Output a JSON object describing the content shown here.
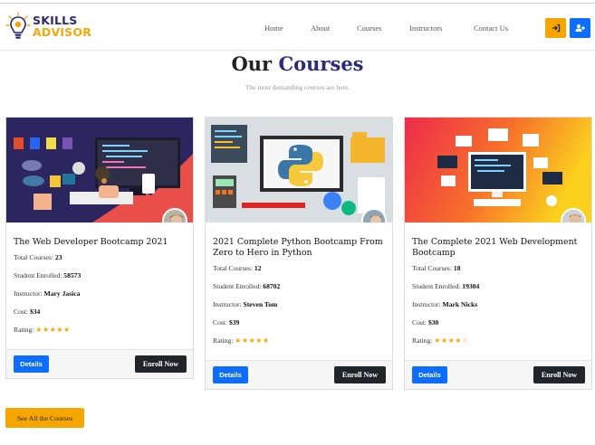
{
  "brand": {
    "line1": "SKILLS",
    "line2": "ADVISOR"
  },
  "nav": {
    "items": [
      "Home",
      "About",
      "Courses",
      "Instructors",
      "Contact Us"
    ],
    "login_icon": "sign-in-icon",
    "register_icon": "user-plus-icon"
  },
  "section": {
    "title_plain": "Our ",
    "title_accent": "Courses",
    "subtitle": "The most demanding courses are here."
  },
  "labels": {
    "total_courses": "Total Courses:",
    "students": "Student Enrolled:",
    "instructor": "Instructor:",
    "cost": "Cost:",
    "rating": "Rating:",
    "details": "Details",
    "enroll": "Enroll Now"
  },
  "courses": [
    {
      "title": "The Web Developer Bootcamp 2021",
      "total": "23",
      "students": "58573",
      "instructor": "Mary Jasica",
      "cost": "$34",
      "stars": "★★★★★",
      "rating": 4.5
    },
    {
      "title": "2021 Complete Python Bootcamp From Zero to Hero in Python",
      "total": "12",
      "students": "68702",
      "instructor": "Steven Tom",
      "cost": "$39",
      "stars": "★★★★★",
      "rating": 4.5
    },
    {
      "title": "The Complete 2021 Web Development Bootcamp",
      "total": "18",
      "students": "19304",
      "instructor": "Mark Nicks",
      "cost": "$30",
      "stars": "★★★★☆",
      "rating": 4
    }
  ],
  "see_all": "See All the Courses",
  "colors": {
    "brand_navy": "#2d2a7c",
    "brand_orange": "#f7a600",
    "primary": "#0d6efd",
    "dark": "#212529"
  }
}
